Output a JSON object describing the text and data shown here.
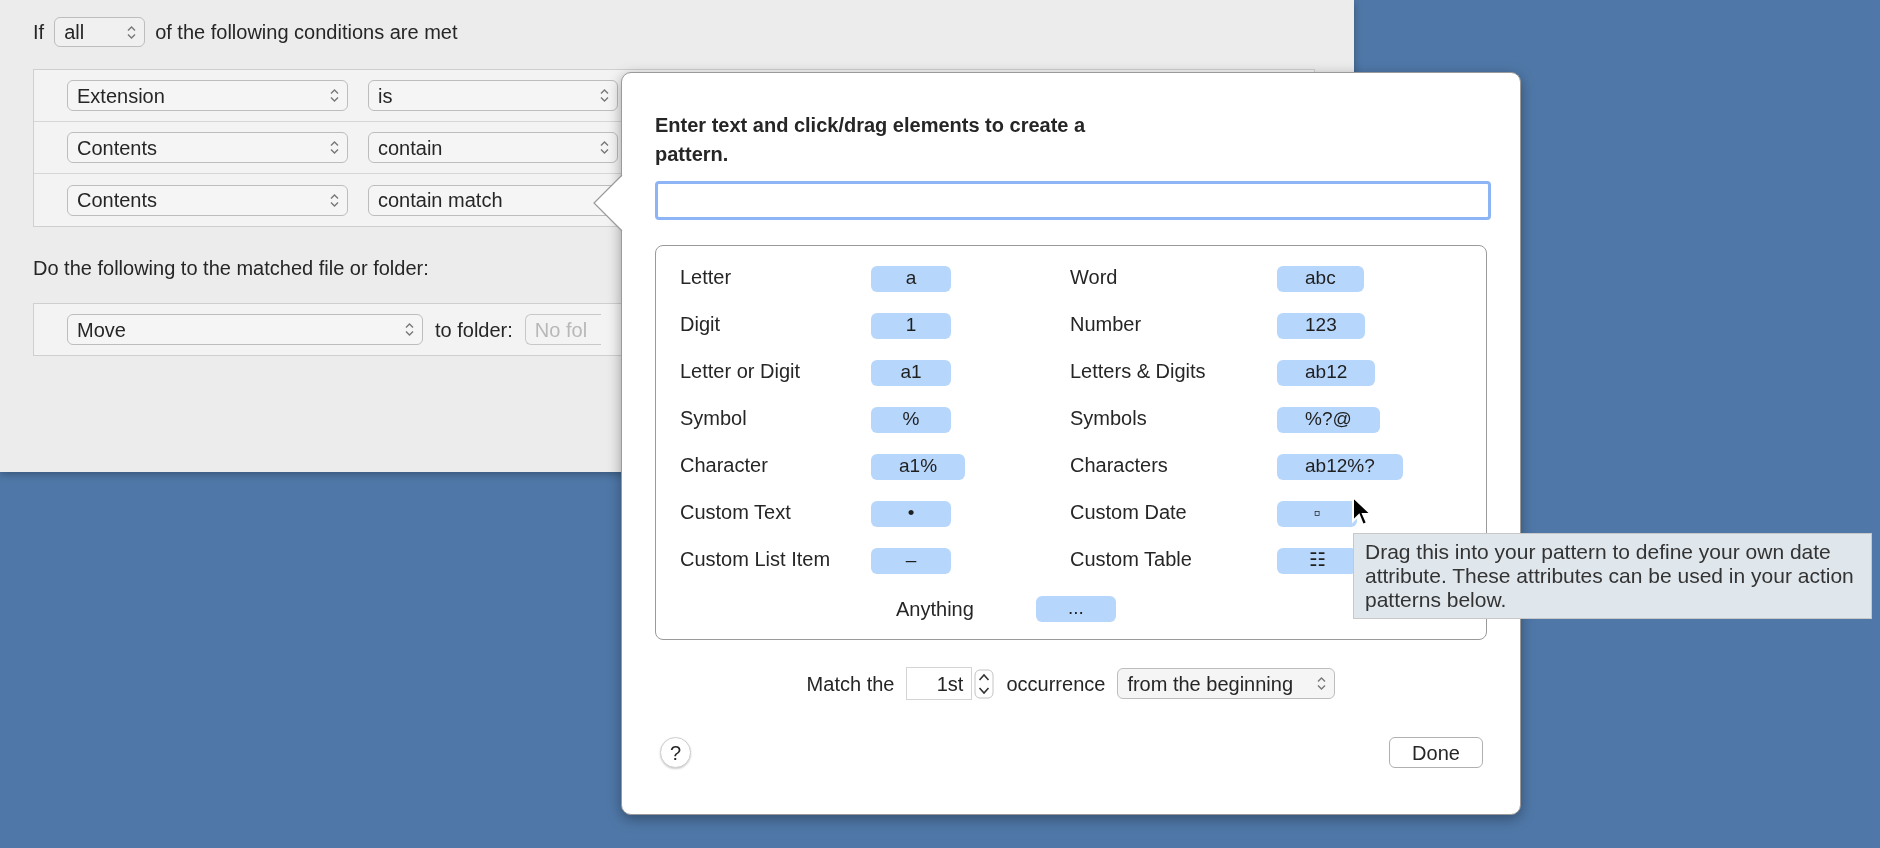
{
  "rule": {
    "prefix": "If",
    "quantifier": "all",
    "suffix": "of the following conditions are met"
  },
  "conditions": [
    {
      "attribute": "Extension",
      "operator": "is"
    },
    {
      "attribute": "Contents",
      "operator": "contain"
    },
    {
      "attribute": "Contents",
      "operator": "contain match"
    }
  ],
  "actions_label": "Do the following to the matched file or folder:",
  "actions": [
    {
      "action": "Move",
      "target_label": "to folder:",
      "target_placeholder": "No fol"
    }
  ],
  "popover": {
    "instruction": "Enter text and click/drag elements to create a pattern.",
    "elements_left": [
      {
        "label": "Letter",
        "token": "a"
      },
      {
        "label": "Digit",
        "token": "1"
      },
      {
        "label": "Letter or Digit",
        "token": "a1"
      },
      {
        "label": "Symbol",
        "token": "%"
      },
      {
        "label": "Character",
        "token": "a1%"
      },
      {
        "label": "Custom Text",
        "token": "•"
      },
      {
        "label": "Custom List Item",
        "token": "–"
      }
    ],
    "elements_right": [
      {
        "label": "Word",
        "token": "abc"
      },
      {
        "label": "Number",
        "token": "123"
      },
      {
        "label": "Letters & Digits",
        "token": "ab12"
      },
      {
        "label": "Symbols",
        "token": "%?@"
      },
      {
        "label": "Characters",
        "token": "ab12%?"
      },
      {
        "label": "Custom Date",
        "token": "▫"
      },
      {
        "label": "Custom Table",
        "token": "☷"
      }
    ],
    "anything": {
      "label": "Anything",
      "token": "..."
    },
    "match": {
      "prefix": "Match the",
      "occurrence": "1st",
      "suffix": "occurrence",
      "direction": "from the beginning"
    },
    "help": "?",
    "done": "Done"
  },
  "tooltip": {
    "text": "Drag this into your pattern to define your own date attribute. These attributes can be used in your action patterns below."
  }
}
